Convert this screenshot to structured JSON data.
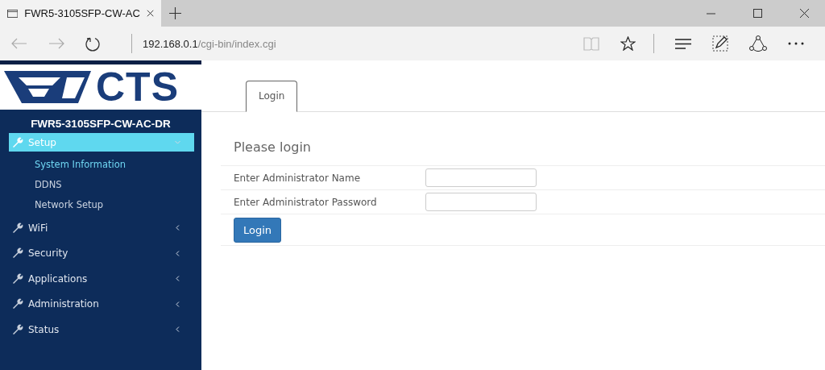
{
  "browser": {
    "tab_title": "FWR5-3105SFP-CW-AC",
    "address_host": "192.168.0.1",
    "address_path": "/cgi-bin/index.cgi"
  },
  "sidebar": {
    "logo_text": "CTS",
    "device_name": "FWR5-3105SFP-CW-AC-DR",
    "items": [
      {
        "label": "Setup",
        "expanded": true,
        "selected": true,
        "children": [
          {
            "label": "System Information",
            "selected": true
          },
          {
            "label": "DDNS",
            "selected": false
          },
          {
            "label": "Network Setup",
            "selected": false
          }
        ]
      },
      {
        "label": "WiFi",
        "expanded": false,
        "selected": false
      },
      {
        "label": "Security",
        "expanded": false,
        "selected": false
      },
      {
        "label": "Applications",
        "expanded": false,
        "selected": false
      },
      {
        "label": "Administration",
        "expanded": false,
        "selected": false
      },
      {
        "label": "Status",
        "expanded": false,
        "selected": false
      }
    ]
  },
  "tabs": [
    {
      "label": "Login",
      "selected": true
    }
  ],
  "form": {
    "title": "Please login",
    "fields": [
      {
        "label": "Enter Administrator Name"
      },
      {
        "label": "Enter Administrator Password"
      }
    ],
    "submit": "Login"
  }
}
